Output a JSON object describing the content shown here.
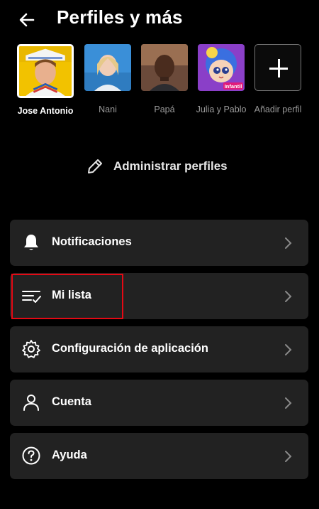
{
  "header": {
    "title": "Perfiles y más",
    "back_icon": "arrow-left-icon"
  },
  "profiles": [
    {
      "name": "Jose Antonio",
      "selected": true
    },
    {
      "name": "Nani",
      "selected": false
    },
    {
      "name": "Papá",
      "selected": false
    },
    {
      "name": "Julia y Pablo",
      "selected": false,
      "badge": "Infantil"
    }
  ],
  "add_profile": {
    "label": "Añadir perfil",
    "icon": "plus-icon"
  },
  "manage": {
    "label": "Administrar perfiles",
    "icon": "pencil-icon"
  },
  "menu": [
    {
      "label": "Notificaciones",
      "icon": "bell-icon"
    },
    {
      "label": "Mi lista",
      "icon": "list-check-icon",
      "highlighted": true
    },
    {
      "label": "Configuración de aplicación",
      "icon": "gear-icon"
    },
    {
      "label": "Cuenta",
      "icon": "user-icon"
    },
    {
      "label": "Ayuda",
      "icon": "help-circle-icon"
    }
  ],
  "colors": {
    "background": "#000000",
    "card": "#222222",
    "highlight": "#e50914",
    "muted_text": "#9a9a9a"
  }
}
